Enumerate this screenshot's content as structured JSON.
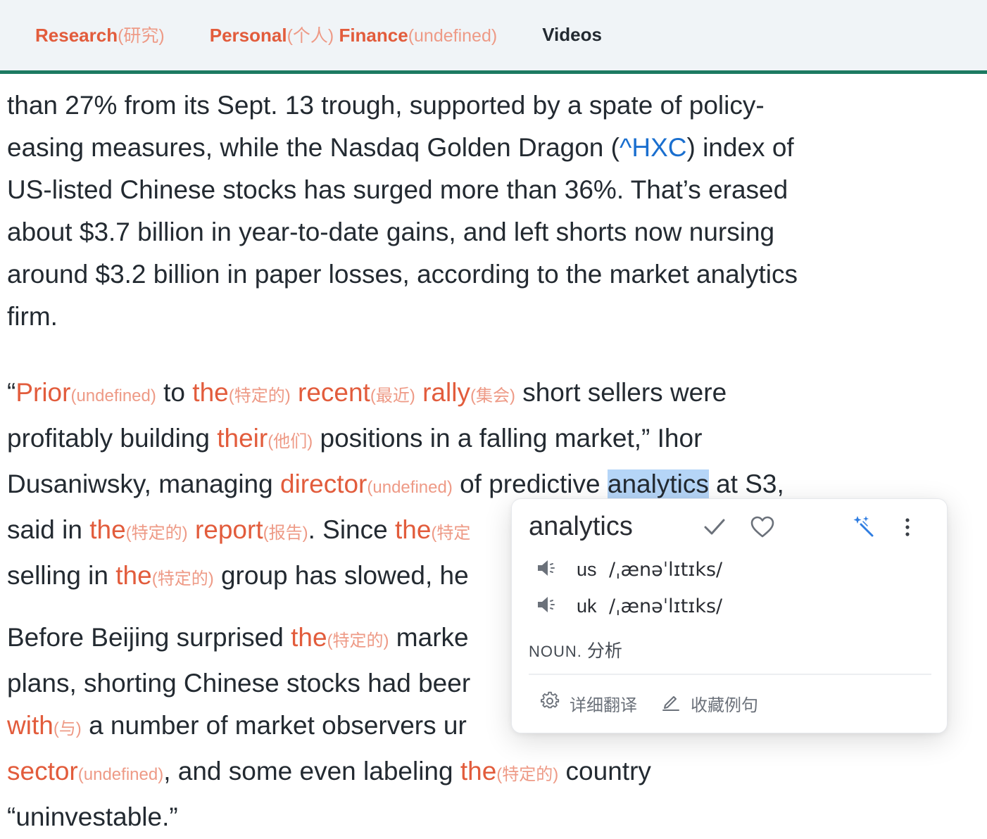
{
  "nav": {
    "items": [
      {
        "label": "Research",
        "translation": "(研究)"
      },
      {
        "label": "Personal",
        "translation": "(个人)",
        "label2": " Finance",
        "translation2": "(undefined)"
      },
      {
        "label": "Videos"
      }
    ]
  },
  "article": {
    "p1": {
      "l1": "than 27% from its Sept. 13 trough, supported by a spate of policy-",
      "l2a": "easing measures, while the Nasdaq Golden Dragon (",
      "l2_link": "^HXC",
      "l2b": ") index of",
      "l3": "US-listed Chinese stocks has surged more than 36%. That’s erased",
      "l4": "about $3.7 billion in year-to-date gains, and left shorts now nursing",
      "l5": "around $3.2 billion in paper losses, according to the market analytics",
      "l6": "firm."
    },
    "p2": {
      "l1": {
        "q": "“",
        "w1": "Prior",
        "t1": "(undefined)",
        "s1": " to ",
        "w2": "the",
        "t2": "(特定的)",
        "s2": " ",
        "w3": "recent",
        "t3": "(最近)",
        "s3": " ",
        "w4": "rally",
        "t4": "(集会)",
        "s4": " short sellers were"
      },
      "l2": {
        "a": "profitably building ",
        "w1": "their",
        "t1": "(他们)",
        "b": " positions in a falling market,” Ihor"
      },
      "l3": {
        "a": "Dusaniwsky, managing ",
        "w1": "director",
        "t1": "(undefined)",
        "b": " of predictive ",
        "sel": "analytics",
        "c": " at S3,"
      },
      "l4": {
        "a": "said in ",
        "w1": "the",
        "t1": "(特定的)",
        "s1": " ",
        "w2": "report",
        "t2": "(报告)",
        "b": ". Since ",
        "w3": "the",
        "t3": "(特定"
      },
      "l5": {
        "a": "selling in ",
        "w1": "the",
        "t1": "(特定的)",
        "b": " group has slowed, he"
      }
    },
    "p3": {
      "l1": {
        "a": "Before Beijing surprised ",
        "w1": "the",
        "t1": "(特定的)",
        "b": " marke"
      },
      "l2": "plans, shorting Chinese stocks had beer",
      "l3": {
        "w1": "with",
        "t1": "(与)",
        "b": " a number of market observers ur"
      },
      "l4": {
        "w1": "sector",
        "t1": "(undefined)",
        "b": ", and some even labeling ",
        "w2": "the",
        "t2": "(特定的)",
        "c": " country"
      },
      "l5": "“uninvestable.”"
    }
  },
  "popup": {
    "word": "analytics",
    "us_label": "us",
    "us_ipa": "/ˌænəˈlɪtɪks/",
    "uk_label": "uk",
    "uk_ipa": "/ˌænəˈlɪtɪks/",
    "pos_tag": "NOUN.",
    "pos_meaning": " 分析",
    "action_detail": "详细翻译",
    "action_save": "收藏例句",
    "icons": {
      "known": "check-icon",
      "favorite": "heart-icon",
      "ai": "sparkle-magic-icon",
      "more": "more-vertical-icon",
      "speaker": "speaker-icon",
      "settings": "gear-icon",
      "edit": "pencil-icon"
    }
  },
  "colors": {
    "accent_orange": "#e25c3c",
    "translation_orange": "#ee9a86",
    "nav_underline": "#1d7a61",
    "link_blue": "#1a6fcf",
    "selection": "#b5d5f7",
    "ai_blue": "#2f7de1"
  }
}
